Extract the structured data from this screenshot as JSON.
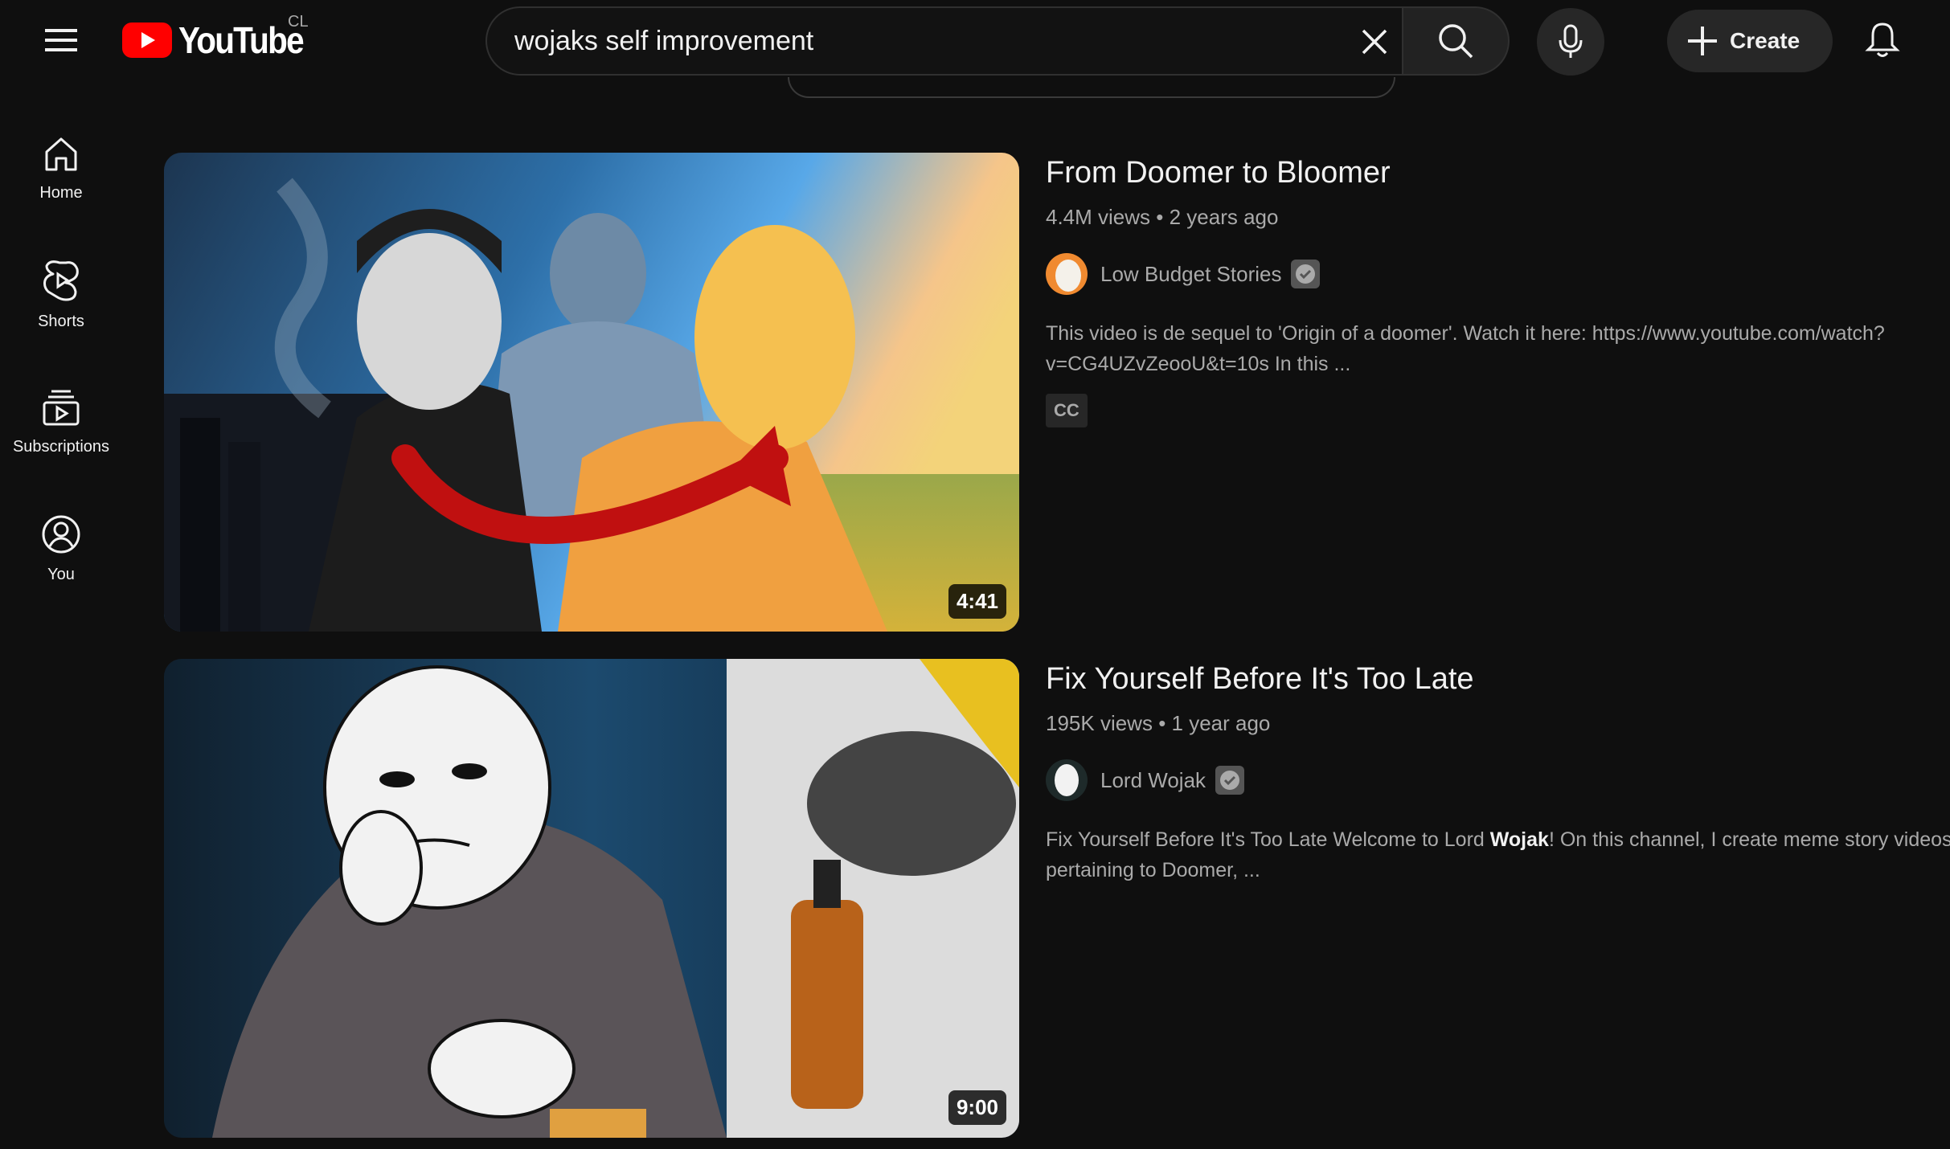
{
  "header": {
    "logo_text": "YouTube",
    "country_code": "CL",
    "search_value": "wojaks self improvement",
    "create_label": "Create"
  },
  "sidebar": {
    "items": [
      {
        "label": "Home",
        "icon": "home-icon"
      },
      {
        "label": "Shorts",
        "icon": "shorts-icon"
      },
      {
        "label": "Subscriptions",
        "icon": "subscriptions-icon"
      },
      {
        "label": "You",
        "icon": "you-icon"
      }
    ]
  },
  "results": [
    {
      "title": "From Doomer to Bloomer",
      "views": "4.4M views",
      "age": "2 years ago",
      "channel": "Low Budget Stories",
      "verified": true,
      "description": "This video is de sequel to 'Origin of a doomer'. Watch it here: https://www.youtube.com/watch?v=CG4UZvZeooU&t=10s In this ...",
      "badge": "CC",
      "duration": "4:41"
    },
    {
      "title": "Fix Yourself Before It's Too Late",
      "views": "195K views",
      "age": "1 year ago",
      "channel": "Lord Wojak",
      "verified": true,
      "description_before": "Fix Yourself Before It's Too Late Welcome to Lord ",
      "description_bold": "Wojak",
      "description_after": "! On this channel, I create meme story videos pertaining to Doomer, ...",
      "duration": "9:00"
    }
  ],
  "colors": {
    "background": "#0f0f0f",
    "brand_red": "#ff0000",
    "text_primary": "#f1f1f1",
    "text_secondary": "#aaaaaa"
  }
}
